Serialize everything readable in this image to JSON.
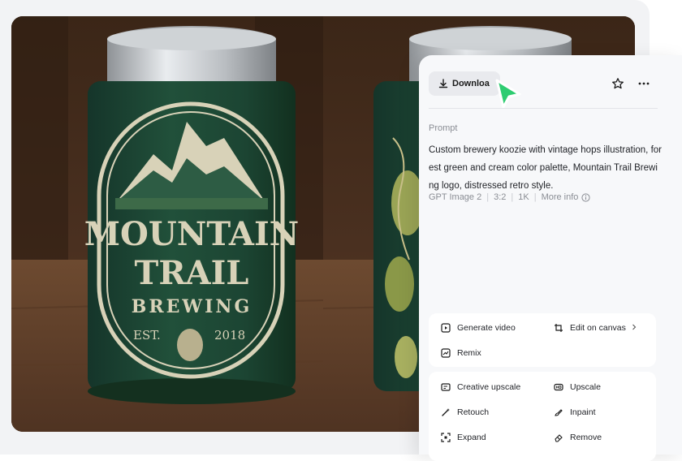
{
  "toolbar": {
    "download_label": "Downloa",
    "star_icon": "star-icon",
    "more_icon": "more-horizontal-icon"
  },
  "prompt": {
    "label": "Prompt",
    "text": "Custom brewery koozie with vintage hops illustration, forest green and cream color palette, Mountain Trail Brewing logo, distressed retro style."
  },
  "meta": {
    "model": "GPT Image 2",
    "ratio": "3:2",
    "resolution": "1K",
    "more_info": "More info"
  },
  "actions_primary": [
    {
      "label": "Generate video",
      "icon": "play-square-icon"
    },
    {
      "label": "Edit on canvas",
      "icon": "crop-icon"
    },
    {
      "label": "Remix",
      "icon": "remix-icon"
    }
  ],
  "actions_secondary": [
    {
      "label": "Creative upscale",
      "icon": "creative-upscale-icon"
    },
    {
      "label": "Upscale",
      "icon": "hd-icon"
    },
    {
      "label": "Retouch",
      "icon": "magic-wand-icon"
    },
    {
      "label": "Inpaint",
      "icon": "inpaint-icon"
    },
    {
      "label": "Expand",
      "icon": "expand-icon"
    },
    {
      "label": "Remove",
      "icon": "eraser-icon"
    }
  ],
  "image": {
    "logo_line1": "MOUNTAIN",
    "logo_line2": "TRAIL",
    "logo_line3": "BREWING",
    "logo_est": "EST.",
    "logo_year": "2018"
  },
  "colors": {
    "koozie_green": "#1f4a34",
    "cream": "#d8d2b8",
    "cursor_green": "#2ecc71",
    "wood": "#6b4a32"
  }
}
